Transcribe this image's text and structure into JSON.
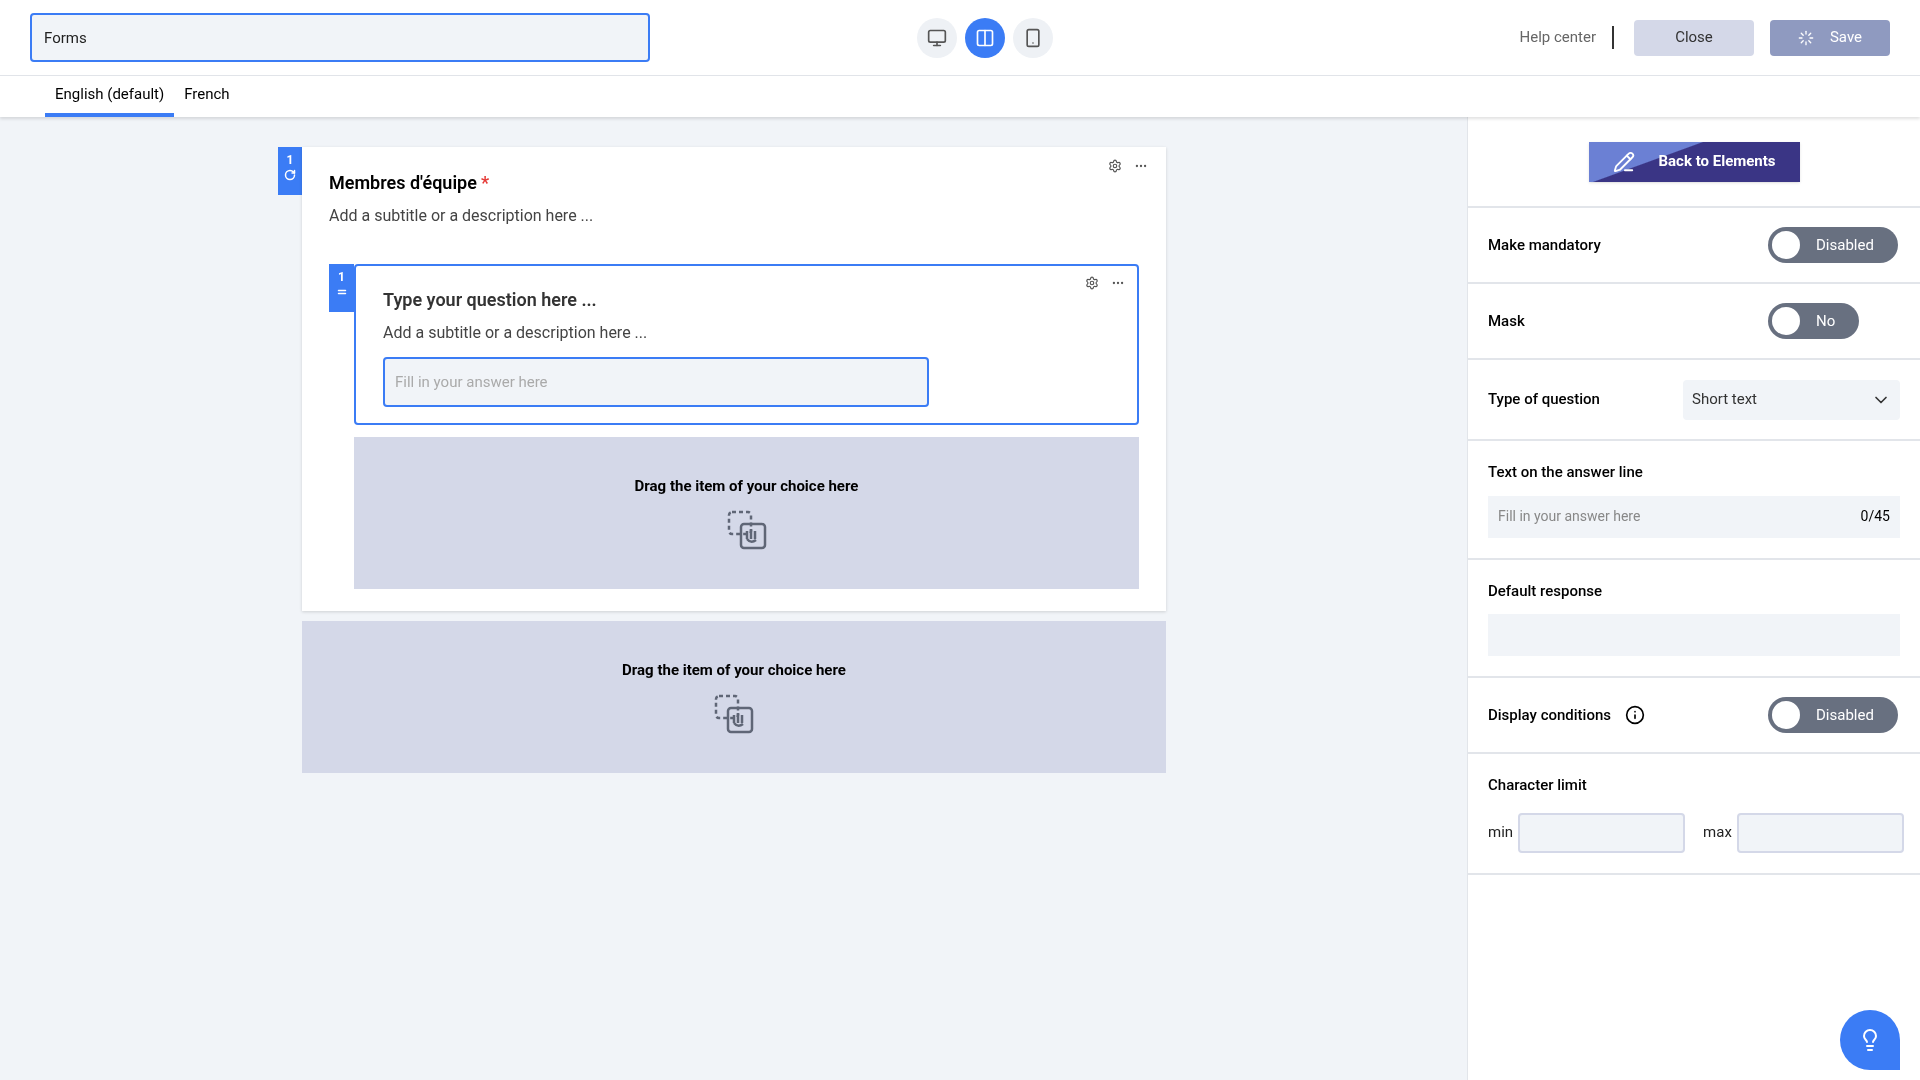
{
  "header": {
    "title_value": "Forms",
    "view_modes": [
      {
        "kind": "desktop",
        "selected": false
      },
      {
        "kind": "split",
        "selected": true
      },
      {
        "kind": "mobile",
        "selected": false
      }
    ],
    "help": "Help center",
    "close": "Close",
    "save": "Save"
  },
  "tabs": [
    {
      "label": "English (default)",
      "selected": true
    },
    {
      "label": "French",
      "selected": false
    }
  ],
  "section": {
    "number": "1",
    "title": "Membres d'équipe",
    "required": true,
    "required_mark": "*",
    "subtitle": "Add a subtitle or a description here ...",
    "question": {
      "number": "1",
      "title": "Type your question here ...",
      "subtitle": "Add a subtitle or a description here ...",
      "placeholder": "Fill in your answer here"
    },
    "inner_drop": "Drag the item of your choice here"
  },
  "outer_drop": "Drag the item of your choice here",
  "panel": {
    "back": "Back to Elements",
    "rows": [
      {
        "kind": "toggle",
        "label": "Make mandatory",
        "on": false,
        "state_text": "Disabled"
      },
      {
        "kind": "toggle",
        "label": "Mask",
        "on": false,
        "state_text": "No"
      },
      {
        "kind": "select",
        "label": "Type of question",
        "value": "Short text"
      },
      {
        "kind": "counter",
        "label": "Text on the answer line",
        "placeholder": "Fill in your answer here",
        "count": "0/45"
      },
      {
        "kind": "textarea",
        "label": "Default response"
      },
      {
        "kind": "toggle",
        "label": "Display conditions",
        "info": true,
        "on": false,
        "state_text": "Disabled"
      },
      {
        "kind": "range",
        "label": "Character limit",
        "min_label": "min",
        "max_label": "max"
      }
    ]
  }
}
